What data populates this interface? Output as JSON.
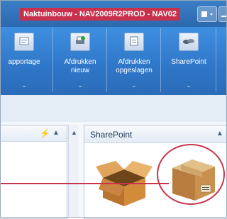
{
  "window": {
    "title": "Naktuinbouw - NAV2009R2PROD - NAV02"
  },
  "ribbon": {
    "groups": [
      {
        "label": "apportage",
        "icon": "report-icon"
      },
      {
        "label": "Afdrukken nieuw",
        "icon": "print-new-icon"
      },
      {
        "label": "Afdrukken opgeslagen",
        "icon": "print-saved-icon"
      },
      {
        "label": "SharePoint",
        "icon": "sharepoint-icon"
      }
    ]
  },
  "left_panel": {
    "header_icons": [
      "lightning-icon",
      "collapse-up-icon"
    ]
  },
  "right_panel": {
    "title": "SharePoint",
    "items": [
      {
        "icon": "open-box-icon"
      },
      {
        "icon": "closed-box-icon",
        "highlighted": true
      }
    ]
  },
  "colors": {
    "titlebar": "#3a7fc7",
    "ribbon": "#2f76c8",
    "title_chip": "#c8304b",
    "annotation": "#c8344c"
  }
}
